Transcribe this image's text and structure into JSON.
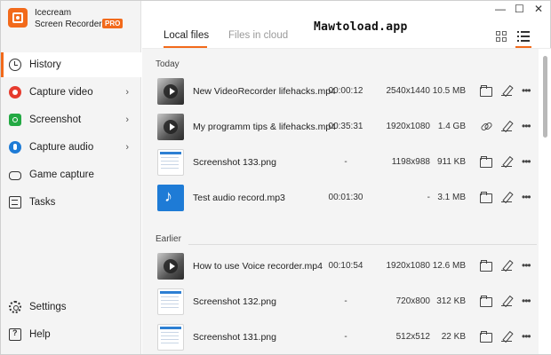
{
  "app": {
    "brand_line1": "Icecream",
    "brand_line2": "Screen Recorder",
    "badge": "PRO",
    "accent_color": "#f26a1b"
  },
  "window_controls": {
    "minimize": "—",
    "maximize": "☐",
    "close": "✕"
  },
  "watermark": "Mawtoload.app",
  "sidebar": {
    "items": [
      {
        "label": "History",
        "icon": "history-icon",
        "active": true,
        "chevron": false
      },
      {
        "label": "Capture video",
        "icon": "record-icon",
        "active": false,
        "chevron": true
      },
      {
        "label": "Screenshot",
        "icon": "camera-icon",
        "active": false,
        "chevron": true
      },
      {
        "label": "Capture audio",
        "icon": "microphone-icon",
        "active": false,
        "chevron": true
      },
      {
        "label": "Game capture",
        "icon": "gamepad-icon",
        "active": false,
        "chevron": false
      },
      {
        "label": "Tasks",
        "icon": "tasks-icon",
        "active": false,
        "chevron": false
      }
    ],
    "bottom": [
      {
        "label": "Settings",
        "icon": "gear-icon"
      },
      {
        "label": "Help",
        "icon": "help-icon"
      }
    ],
    "chevron_glyph": "›"
  },
  "tabs": [
    {
      "label": "Local files",
      "active": true
    },
    {
      "label": "Files in cloud",
      "active": false
    }
  ],
  "view_modes": [
    "grid-view-icon",
    "list-view-icon"
  ],
  "sections": [
    {
      "label": "Today",
      "rows": [
        {
          "type": "video",
          "name": "New VideoRecorder lifehacks.mp4",
          "duration": "00:00:12",
          "resolution": "2540x1440",
          "size": "10.5 MB",
          "action1": "folder-icon"
        },
        {
          "type": "video",
          "name": "My programm tips & lifehacks.mp4",
          "duration": "00:35:31",
          "resolution": "1920x1080",
          "size": "1.4 GB",
          "action1": "link-icon"
        },
        {
          "type": "image",
          "name": "Screenshot 133.png",
          "duration": "-",
          "resolution": "1198x988",
          "size": "911 KB",
          "action1": "folder-icon"
        },
        {
          "type": "audio",
          "name": "Test audio record.mp3",
          "duration": "00:01:30",
          "resolution": "-",
          "size": "3.1 MB",
          "action1": "folder-icon"
        }
      ]
    },
    {
      "label": "Earlier",
      "rows": [
        {
          "type": "video",
          "name": "How to use Voice recorder.mp4",
          "duration": "00:10:54",
          "resolution": "1920x1080",
          "size": "12.6 MB",
          "action1": "folder-icon"
        },
        {
          "type": "image",
          "name": "Screenshot 132.png",
          "duration": "-",
          "resolution": "720x800",
          "size": "312 KB",
          "action1": "folder-icon"
        },
        {
          "type": "image",
          "name": "Screenshot 131.png",
          "duration": "-",
          "resolution": "512x512",
          "size": "22 KB",
          "action1": "folder-icon"
        }
      ]
    }
  ],
  "more_glyph": "•••"
}
